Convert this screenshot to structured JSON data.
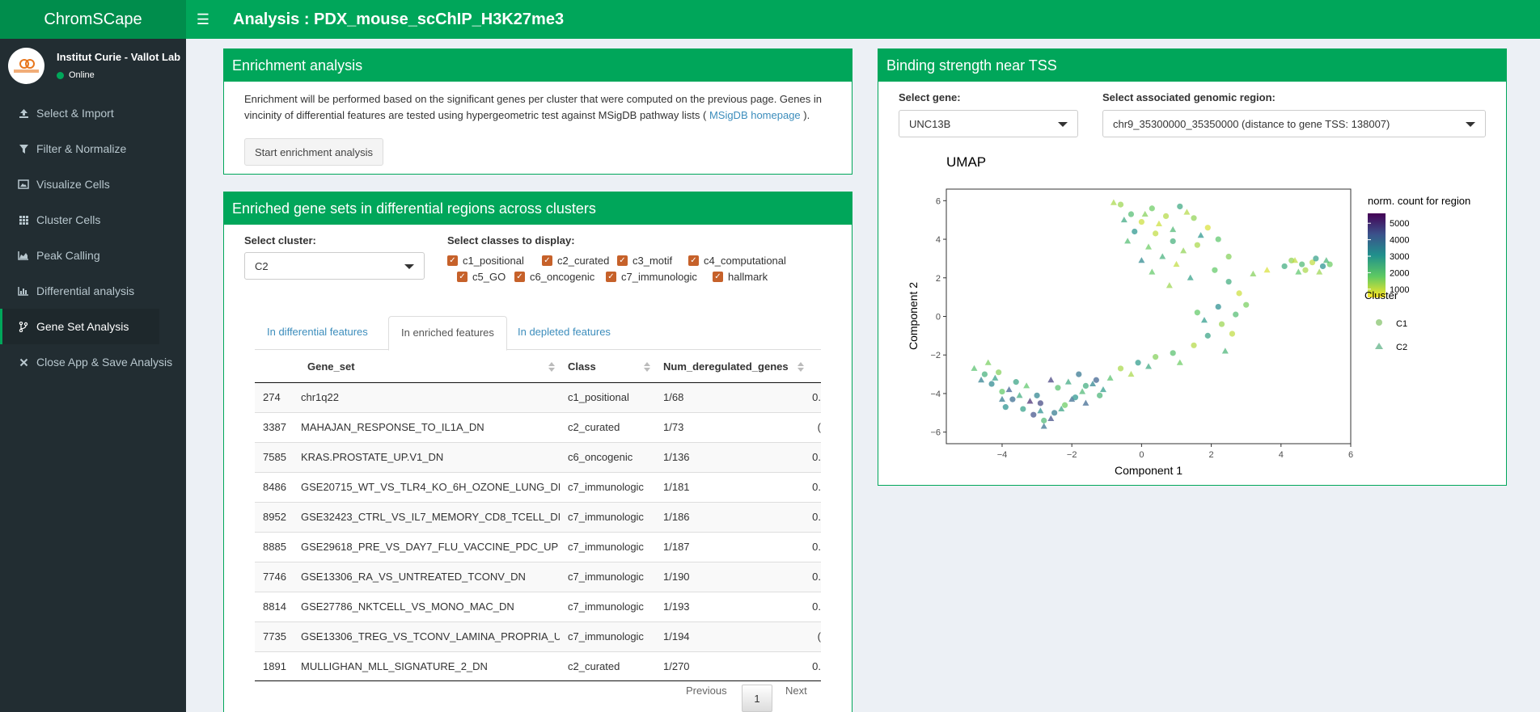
{
  "header": {
    "brand": "ChromSCape",
    "title": "Analysis : PDX_mouse_scChIP_H3K27me3"
  },
  "user": {
    "name": "Institut Curie - Vallot Lab",
    "status": "Online",
    "logo_text": "institut Curie"
  },
  "sidebar": {
    "items": [
      {
        "label": "Select & Import",
        "icon": "upload-icon"
      },
      {
        "label": "Filter & Normalize",
        "icon": "filter-icon"
      },
      {
        "label": "Visualize Cells",
        "icon": "image-icon"
      },
      {
        "label": "Cluster Cells",
        "icon": "grid-icon"
      },
      {
        "label": "Peak Calling",
        "icon": "area-chart-icon"
      },
      {
        "label": "Differential analysis",
        "icon": "bar-chart-icon"
      },
      {
        "label": "Gene Set Analysis",
        "icon": "code-fork-icon",
        "active": true
      },
      {
        "label": "Close App & Save Analysis",
        "icon": "close-icon"
      }
    ]
  },
  "enrichment": {
    "title": "Enrichment analysis",
    "text_before": "Enrichment will be performed based on the significant genes per cluster that were computed on the previous page. Genes in vincinity of differential features are tested using hypergeometric test against MSigDB pathway lists ( ",
    "link": "MSigDB homepage",
    "text_after": " ).",
    "button": "Start enrichment analysis"
  },
  "gene_sets": {
    "title": "Enriched gene sets in differential regions across clusters",
    "cluster_label": "Select cluster:",
    "cluster_value": "C2",
    "classes_label": "Select classes to display:",
    "classes": [
      "c1_positional",
      "c2_curated",
      "c3_motif",
      "c4_computational",
      "c5_GO",
      "c6_oncogenic",
      "c7_immunologic",
      "hallmark"
    ],
    "tabs": [
      "In differential features",
      "In enriched features",
      "In depleted features"
    ],
    "columns": [
      "",
      "Gene_set",
      "Class",
      "Num_deregulated_genes"
    ],
    "rows": [
      [
        "274",
        "chr1q22",
        "c1_positional",
        "1/68",
        "0."
      ],
      [
        "3387",
        "MAHAJAN_RESPONSE_TO_IL1A_DN",
        "c2_curated",
        "1/73",
        "("
      ],
      [
        "7585",
        "KRAS.PROSTATE_UP.V1_DN",
        "c6_oncogenic",
        "1/136",
        "0."
      ],
      [
        "8486",
        "GSE20715_WT_VS_TLR4_KO_6H_OZONE_LUNG_DN",
        "c7_immunologic",
        "1/181",
        "0."
      ],
      [
        "8952",
        "GSE32423_CTRL_VS_IL7_MEMORY_CD8_TCELL_DN",
        "c7_immunologic",
        "1/186",
        "0."
      ],
      [
        "8885",
        "GSE29618_PRE_VS_DAY7_FLU_VACCINE_PDC_UP",
        "c7_immunologic",
        "1/187",
        "0."
      ],
      [
        "7746",
        "GSE13306_RA_VS_UNTREATED_TCONV_DN",
        "c7_immunologic",
        "1/190",
        "0."
      ],
      [
        "8814",
        "GSE27786_NKTCELL_VS_MONO_MAC_DN",
        "c7_immunologic",
        "1/193",
        "0."
      ],
      [
        "7735",
        "GSE13306_TREG_VS_TCONV_LAMINA_PROPRIA_UP",
        "c7_immunologic",
        "1/194",
        "("
      ],
      [
        "1891",
        "MULLIGHAN_MLL_SIGNATURE_2_DN",
        "c2_curated",
        "1/270",
        "0."
      ]
    ],
    "pager": {
      "previous": "Previous",
      "page": "1",
      "next": "Next"
    }
  },
  "binding": {
    "title": "Binding strength near TSS",
    "gene_label": "Select gene:",
    "gene_value": "UNC13B",
    "region_label": "Select associated genomic region:",
    "region_value": "chr9_35300000_35350000 (distance to gene TSS: 138007)"
  },
  "chart_data": {
    "type": "scatter",
    "title": "UMAP",
    "xlabel": "Component 1",
    "ylabel": "Component 2",
    "xlim": [
      -5.6,
      6.0
    ],
    "ylim": [
      -6.6,
      6.6
    ],
    "xticks": [
      -4,
      -2,
      0,
      2,
      4,
      6
    ],
    "yticks": [
      -6,
      -4,
      -2,
      0,
      2,
      4,
      6
    ],
    "xtick_labels": [
      "−4",
      "−2",
      "0",
      "2",
      "4",
      "6"
    ],
    "ytick_labels": [
      "−6",
      "−4",
      "−2",
      "0",
      "2",
      "4",
      "6"
    ],
    "color_legend_title": "norm. count for region",
    "color_ticks": [
      1000,
      2000,
      3000,
      4000,
      5000
    ],
    "color_min": 500,
    "color_max": 5600,
    "shape_legend_title": "Cluster",
    "legend_position": "right",
    "series": [
      {
        "name": "C1",
        "marker": "circle",
        "points": [
          [
            -4.5,
            -3.0,
            2400
          ],
          [
            -4.3,
            -3.5,
            3300
          ],
          [
            -4.0,
            -3.9,
            1800
          ],
          [
            -3.7,
            -4.3,
            3900
          ],
          [
            -3.4,
            -4.8,
            2800
          ],
          [
            -3.1,
            -5.1,
            4400
          ],
          [
            -2.8,
            -5.4,
            2200
          ],
          [
            -2.5,
            -5.0,
            3600
          ],
          [
            -2.2,
            -4.6,
            1700
          ],
          [
            -1.9,
            -4.2,
            3000
          ],
          [
            -1.6,
            -3.6,
            2500
          ],
          [
            -1.3,
            -3.3,
            4100
          ],
          [
            -4.1,
            -2.9,
            1500
          ],
          [
            -3.6,
            -3.4,
            2700
          ],
          [
            -3.0,
            -4.1,
            3400
          ],
          [
            -2.4,
            -3.7,
            2000
          ],
          [
            -1.8,
            -3.0,
            3700
          ],
          [
            -1.2,
            -4.1,
            2300
          ],
          [
            -3.9,
            -4.7,
            3100
          ],
          [
            -2.9,
            -4.5,
            4600
          ],
          [
            -0.6,
            5.8,
            1300
          ],
          [
            -0.3,
            5.3,
            2100
          ],
          [
            0.0,
            4.9,
            900
          ],
          [
            0.3,
            5.6,
            1700
          ],
          [
            0.7,
            5.2,
            1100
          ],
          [
            1.1,
            5.7,
            2600
          ],
          [
            1.5,
            5.1,
            1400
          ],
          [
            1.9,
            4.6,
            800
          ],
          [
            2.2,
            4.0,
            1900
          ],
          [
            1.6,
            3.7,
            1200
          ],
          [
            0.9,
            3.9,
            2400
          ],
          [
            0.4,
            4.3,
            1000
          ],
          [
            -0.2,
            4.4,
            3000
          ],
          [
            2.5,
            3.1,
            1500
          ],
          [
            2.1,
            2.4,
            1800
          ],
          [
            2.5,
            1.8,
            2500
          ],
          [
            2.8,
            1.2,
            900
          ],
          [
            3.0,
            0.6,
            1600
          ],
          [
            2.7,
            0.1,
            2100
          ],
          [
            2.3,
            -0.4,
            1300
          ],
          [
            1.9,
            -1.0,
            2700
          ],
          [
            1.5,
            -1.5,
            1100
          ],
          [
            0.9,
            -1.9,
            2000
          ],
          [
            0.4,
            -2.1,
            1500
          ],
          [
            -0.1,
            -2.4,
            2900
          ],
          [
            -0.6,
            -2.7,
            1200
          ],
          [
            2.2,
            0.5,
            3200
          ],
          [
            1.6,
            0.2,
            1800
          ],
          [
            2.6,
            -0.9,
            1000
          ],
          [
            4.3,
            2.9,
            1400
          ],
          [
            4.6,
            2.7,
            2200
          ],
          [
            4.9,
            2.8,
            1000
          ],
          [
            5.2,
            2.6,
            3100
          ],
          [
            5.4,
            2.7,
            1700
          ],
          [
            4.1,
            2.6,
            2500
          ],
          [
            4.7,
            2.4,
            1200
          ],
          [
            5.0,
            3.0,
            2800
          ]
        ]
      },
      {
        "name": "C2",
        "marker": "triangle",
        "points": [
          [
            -4.8,
            -2.7,
            2000
          ],
          [
            -4.6,
            -3.3,
            3500
          ],
          [
            -4.2,
            -3.2,
            2800
          ],
          [
            -3.8,
            -3.8,
            4200
          ],
          [
            -3.5,
            -4.1,
            2500
          ],
          [
            -3.2,
            -4.4,
            5000
          ],
          [
            -2.9,
            -4.9,
            3200
          ],
          [
            -2.6,
            -5.3,
            4500
          ],
          [
            -2.3,
            -4.8,
            2700
          ],
          [
            -2.0,
            -4.3,
            3900
          ],
          [
            -1.7,
            -3.9,
            2200
          ],
          [
            -1.4,
            -3.5,
            3400
          ],
          [
            -1.1,
            -3.8,
            2900
          ],
          [
            -2.6,
            -3.3,
            4700
          ],
          [
            -3.3,
            -3.6,
            1900
          ],
          [
            -4.0,
            -4.3,
            3600
          ],
          [
            -2.1,
            -3.4,
            2600
          ],
          [
            -1.6,
            -4.5,
            4000
          ],
          [
            -4.4,
            -2.4,
            1600
          ],
          [
            -2.8,
            -5.7,
            3800
          ],
          [
            -0.8,
            5.9,
            1200
          ],
          [
            -0.5,
            5.0,
            2600
          ],
          [
            0.1,
            5.3,
            1500
          ],
          [
            0.5,
            4.8,
            900
          ],
          [
            0.9,
            4.5,
            2200
          ],
          [
            1.3,
            5.4,
            1100
          ],
          [
            1.7,
            4.2,
            3000
          ],
          [
            0.2,
            3.6,
            1700
          ],
          [
            0.6,
            3.1,
            2400
          ],
          [
            1.0,
            2.7,
            1000
          ],
          [
            0.3,
            2.3,
            1800
          ],
          [
            1.4,
            2.0,
            2800
          ],
          [
            0.8,
            1.6,
            1300
          ],
          [
            -0.4,
            3.9,
            2100
          ],
          [
            0.0,
            2.9,
            3300
          ],
          [
            1.2,
            3.4,
            1400
          ],
          [
            3.6,
            2.4,
            800
          ],
          [
            3.2,
            2.2,
            1500
          ],
          [
            2.4,
            -1.8,
            2300
          ],
          [
            1.1,
            -2.4,
            1700
          ],
          [
            0.2,
            -2.6,
            2600
          ],
          [
            -0.3,
            -3.0,
            1200
          ],
          [
            -0.9,
            -3.2,
            2000
          ],
          [
            1.8,
            -0.2,
            2900
          ],
          [
            4.5,
            2.3,
            1900
          ],
          [
            5.1,
            2.3,
            1300
          ],
          [
            5.3,
            2.9,
            2300
          ],
          [
            4.4,
            2.9,
            1000
          ]
        ]
      }
    ]
  }
}
